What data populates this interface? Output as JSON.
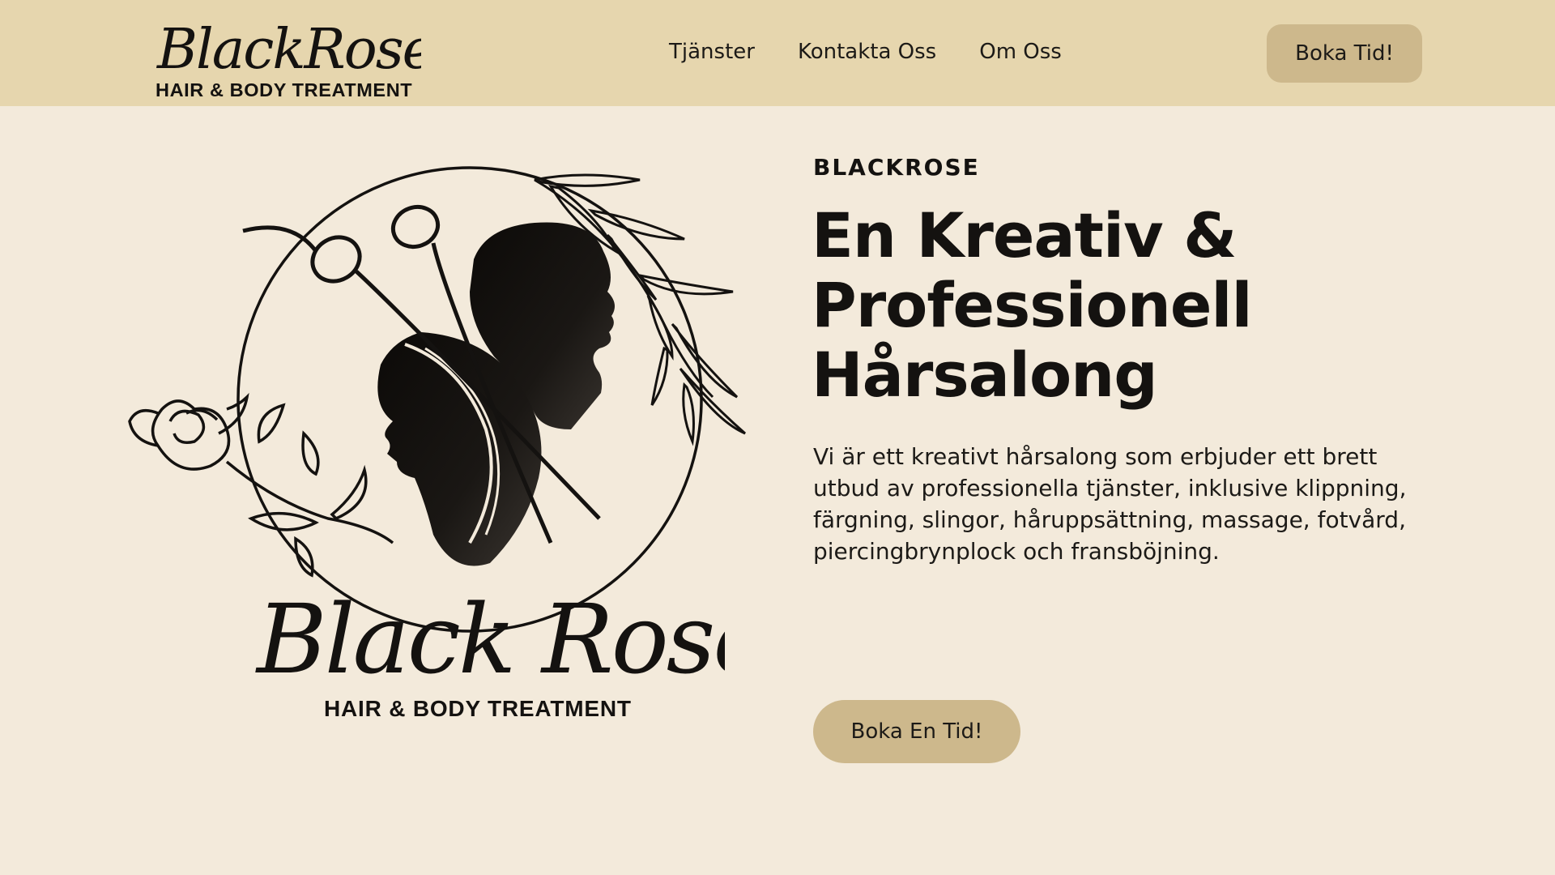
{
  "header": {
    "brand_script": "BlackRose",
    "brand_sub": "HAIR & BODY TREATMENT",
    "nav": [
      {
        "label": "Tjänster"
      },
      {
        "label": "Kontakta Oss"
      },
      {
        "label": "Om Oss"
      }
    ],
    "book_label": "Boka Tid!"
  },
  "hero": {
    "logo_script": "Black Rose",
    "logo_sub": "HAIR & BODY TREATMENT",
    "eyebrow": "BLACKROSE",
    "headline_line1": "En Kreativ &",
    "headline_line2": "Professionell",
    "headline_line3": "Hårsalong",
    "lead": "Vi är ett kreativt hårsalong som erbjuder ett brett utbud av professionella tjänster, inklusive klippning, färgning, slingor, håruppsättning, massage, fotvård, piercingbrynplock och fransböjning.",
    "cta_label": "Boka En Tid!"
  },
  "colors": {
    "header_bg": "#e6d6ae",
    "page_bg": "#f3eadb",
    "button_bg": "#cdb88c",
    "text": "#141210"
  },
  "icons": {
    "logo_graphic": "scissors-silhouettes-rose-logo"
  }
}
